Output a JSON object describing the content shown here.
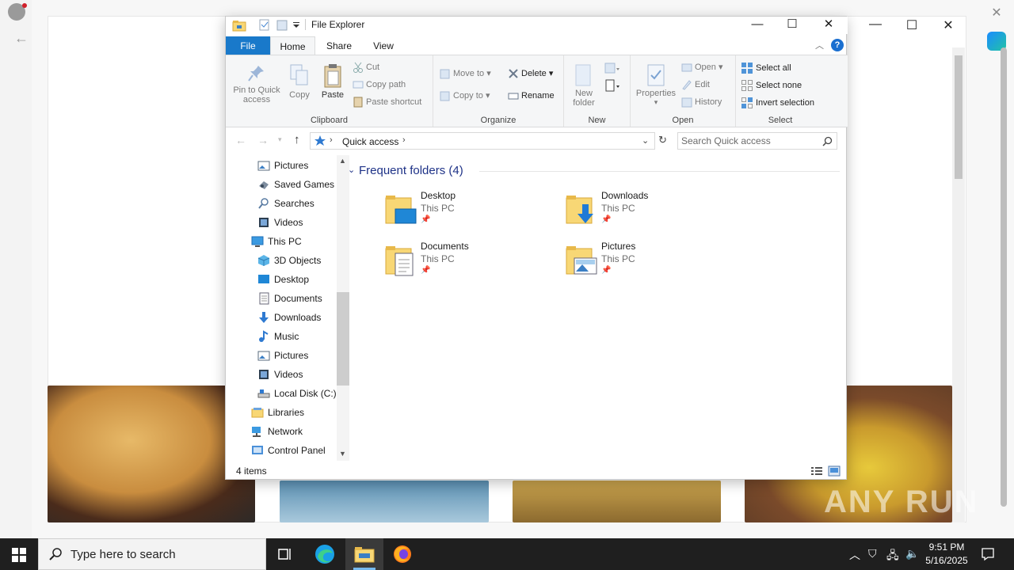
{
  "explorer": {
    "title": "File Explorer",
    "tabs": {
      "file": "File",
      "home": "Home",
      "share": "Share",
      "view": "View"
    },
    "help": "?",
    "ribbon": {
      "clipboard": {
        "label": "Clipboard",
        "pin": "Pin to Quick access",
        "copy": "Copy",
        "paste": "Paste",
        "cut": "Cut",
        "copy_path": "Copy path",
        "paste_shortcut": "Paste shortcut"
      },
      "organize": {
        "label": "Organize",
        "move_to": "Move to",
        "copy_to": "Copy to",
        "delete": "Delete",
        "rename": "Rename"
      },
      "new": {
        "label": "New",
        "new_folder": "New folder"
      },
      "open": {
        "label": "Open",
        "properties": "Properties",
        "open": "Open",
        "edit": "Edit",
        "history": "History"
      },
      "select": {
        "label": "Select",
        "select_all": "Select all",
        "select_none": "Select none",
        "invert": "Invert selection"
      }
    },
    "address": {
      "path": "Quick access"
    },
    "search": {
      "placeholder": "Search Quick access"
    },
    "nav": [
      {
        "label": "Pictures",
        "icon": "pictures-icon"
      },
      {
        "label": "Saved Games",
        "icon": "saved-games-icon"
      },
      {
        "label": "Searches",
        "icon": "search-icon"
      },
      {
        "label": "Videos",
        "icon": "videos-icon"
      },
      {
        "label": "This PC",
        "icon": "computer-icon"
      },
      {
        "label": "3D Objects",
        "icon": "3d-objects-icon"
      },
      {
        "label": "Desktop",
        "icon": "desktop-icon"
      },
      {
        "label": "Documents",
        "icon": "documents-icon"
      },
      {
        "label": "Downloads",
        "icon": "downloads-icon"
      },
      {
        "label": "Music",
        "icon": "music-icon"
      },
      {
        "label": "Pictures",
        "icon": "pictures-icon"
      },
      {
        "label": "Videos",
        "icon": "videos-icon"
      },
      {
        "label": "Local Disk (C:)",
        "icon": "drive-icon"
      },
      {
        "label": "Libraries",
        "icon": "libraries-icon"
      },
      {
        "label": "Network",
        "icon": "network-icon"
      },
      {
        "label": "Control Panel",
        "icon": "control-panel-icon"
      }
    ],
    "frequent": {
      "header": "Frequent folders (4)",
      "items": [
        {
          "name": "Desktop",
          "location": "This PC",
          "icon": "desktop-folder-icon"
        },
        {
          "name": "Downloads",
          "location": "This PC",
          "icon": "downloads-folder-icon"
        },
        {
          "name": "Documents",
          "location": "This PC",
          "icon": "documents-folder-icon"
        },
        {
          "name": "Pictures",
          "location": "This PC",
          "icon": "pictures-folder-icon"
        }
      ]
    },
    "status": "4 items"
  },
  "taskbar": {
    "search_placeholder": "Type here to search",
    "time": "9:51 PM",
    "date": "5/16/2025"
  },
  "background": {
    "watermark": "ANY RUN"
  },
  "colors": {
    "accent": "#1979ca",
    "taskbar": "#1f1f1f",
    "folder_yellow": "#f8d775",
    "header_blue": "#1e3287"
  }
}
